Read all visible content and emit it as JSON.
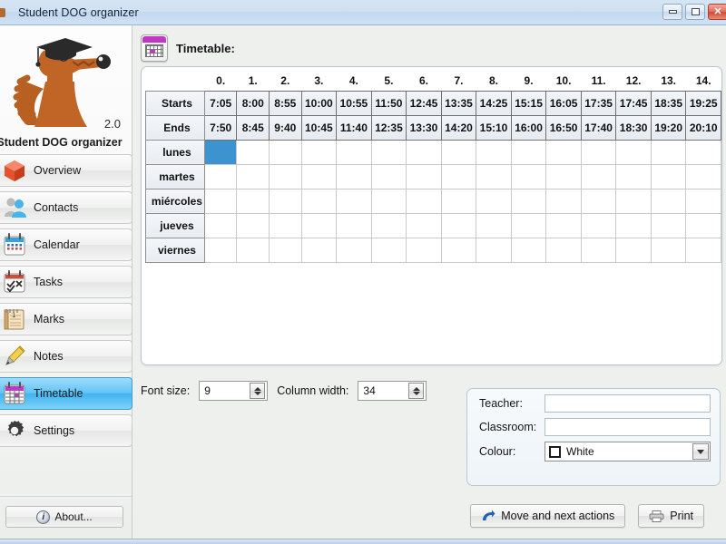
{
  "window": {
    "title": "Student DOG organizer",
    "icon": "app-icon",
    "buttons": [
      {
        "name": "minimize",
        "glyph": "minimize-icon"
      },
      {
        "name": "maximize",
        "glyph": "maximize-icon"
      },
      {
        "name": "close",
        "glyph": "close-icon",
        "color": "#cf4a33"
      }
    ]
  },
  "sidebar": {
    "app_name": "Student DOG organizer",
    "version": "2.0",
    "logo": "dog-graduate-logo",
    "items": [
      {
        "label": "Overview",
        "icon": "cube-icon",
        "active": false
      },
      {
        "label": "Contacts",
        "icon": "people-icon",
        "active": false
      },
      {
        "label": "Calendar",
        "icon": "calendar-icon",
        "active": false
      },
      {
        "label": "Tasks",
        "icon": "checklist-icon",
        "active": false
      },
      {
        "label": "Marks",
        "icon": "notebook-icon",
        "active": false
      },
      {
        "label": "Notes",
        "icon": "pencil-icon",
        "active": false
      },
      {
        "label": "Timetable",
        "icon": "timetable-icon",
        "active": true
      },
      {
        "label": "Settings",
        "icon": "gear-icon",
        "active": false
      }
    ],
    "about_label": "About...",
    "about_icon": "info-icon"
  },
  "main": {
    "header_title": "Timetable:",
    "header_icon": "timetable-icon",
    "accent_color": "#3d93d0"
  },
  "timetable": {
    "column_headers": [
      "0.",
      "1.",
      "2.",
      "3.",
      "4.",
      "5.",
      "6.",
      "7.",
      "8.",
      "9.",
      "10.",
      "11.",
      "12.",
      "13.",
      "14."
    ],
    "starts_label": "Starts",
    "ends_label": "Ends",
    "starts": [
      "7:05",
      "8:00",
      "8:55",
      "10:00",
      "10:55",
      "11:50",
      "12:45",
      "13:35",
      "14:25",
      "15:15",
      "16:05",
      "17:35",
      "17:45",
      "18:35",
      "19:25"
    ],
    "ends": [
      "7:50",
      "8:45",
      "9:40",
      "10:45",
      "11:40",
      "12:35",
      "13:30",
      "14:20",
      "15:10",
      "16:00",
      "16:50",
      "17:40",
      "18:30",
      "19:20",
      "20:10"
    ],
    "days": [
      "lunes",
      "martes",
      "miércoles",
      "jueves",
      "viernes"
    ],
    "selected_cell": {
      "day": "lunes",
      "column": "0."
    },
    "cells": [
      [
        "",
        "",
        "",
        "",
        "",
        "",
        "",
        "",
        "",
        "",
        "",
        "",
        "",
        "",
        ""
      ],
      [
        "",
        "",
        "",
        "",
        "",
        "",
        "",
        "",
        "",
        "",
        "",
        "",
        "",
        "",
        ""
      ],
      [
        "",
        "",
        "",
        "",
        "",
        "",
        "",
        "",
        "",
        "",
        "",
        "",
        "",
        "",
        ""
      ],
      [
        "",
        "",
        "",
        "",
        "",
        "",
        "",
        "",
        "",
        "",
        "",
        "",
        "",
        "",
        ""
      ],
      [
        "",
        "",
        "",
        "",
        "",
        "",
        "",
        "",
        "",
        "",
        "",
        "",
        "",
        "",
        ""
      ]
    ]
  },
  "settings": {
    "font_size_label": "Font size:",
    "font_size_value": "9",
    "column_width_label": "Column width:",
    "column_width_value": "34"
  },
  "detail": {
    "teacher_label": "Teacher:",
    "teacher_value": "",
    "teacher_placeholder": "",
    "classroom_label": "Classroom:",
    "classroom_value": "",
    "classroom_placeholder": "",
    "colour_label": "Colour:",
    "colour_value": "White",
    "colour_swatch": "#ffffff"
  },
  "actions": {
    "move_label": "Move and next actions",
    "move_icon": "move-arrow-icon",
    "print_label": "Print",
    "print_icon": "printer-icon"
  }
}
